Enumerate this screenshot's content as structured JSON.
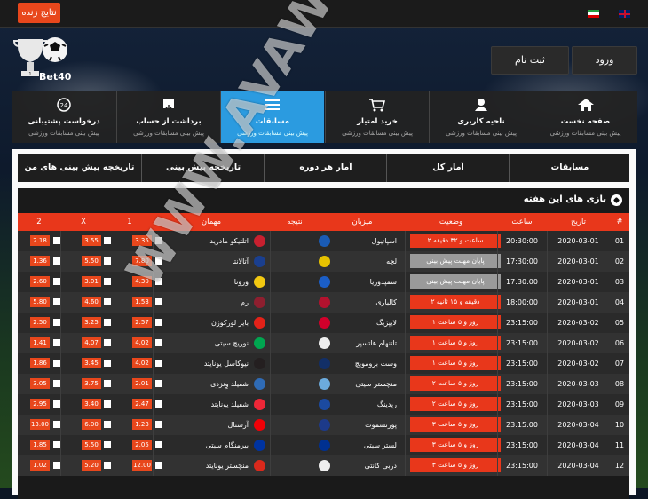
{
  "topbar": {
    "live_label": "نتایج زنده"
  },
  "header": {
    "logo_text": "Bet40",
    "login_label": "ورود",
    "register_label": "ثبت نام"
  },
  "nav": [
    {
      "label": "صفحه نخست",
      "sub": "پیش بینی مسابقات ورزشی",
      "icon": "home-icon",
      "active": false
    },
    {
      "label": "ناحیه کاربری",
      "sub": "پیش بینی مسابقات ورزشی",
      "icon": "user-icon",
      "active": false
    },
    {
      "label": "خرید امتیاز",
      "sub": "پیش بینی مسابقات ورزشی",
      "icon": "cart-icon",
      "active": false
    },
    {
      "label": "مسابقات",
      "sub": "پیش بینی مسابقات ورزشی",
      "icon": "list-icon",
      "active": true
    },
    {
      "label": "برداشت از حساب",
      "sub": "پیش بینی مسابقات ورزشی",
      "icon": "withdraw-icon",
      "active": false
    },
    {
      "label": "درخواست پشتیبانی",
      "sub": "پیش بینی مسابقات ورزشی",
      "icon": "support-24-icon",
      "active": false
    }
  ],
  "tabs": [
    "مسابقات",
    "آمار کل",
    "آمار هر دوره",
    "تاریخچه پیش بینی",
    "تاریخچه پیش بینی های من"
  ],
  "section": {
    "title": "بازی های این هفته"
  },
  "columns": {
    "num": "#",
    "date": "تاریخ",
    "time": "ساعت",
    "status": "وضعیت",
    "host": "میزبان",
    "result": "نتیجه",
    "guest": "مهمان",
    "one": "1",
    "x": "X",
    "two": "2"
  },
  "rows": [
    {
      "num": "01",
      "date": "2020-03-01",
      "time": "20:30:00",
      "status": "۲ ساعت و ۳۲ دقیقه",
      "status_kind": "red",
      "host": "اسپانیول",
      "host_color": "#1a5bb5",
      "guest": "اتلتیکو مادرید",
      "guest_color": "#c8202f",
      "one": "3.35",
      "x": "3.55",
      "two": "2.18"
    },
    {
      "num": "02",
      "date": "2020-03-01",
      "time": "17:30:00",
      "status": "پایان مهلت پیش بینی",
      "status_kind": "gray",
      "host": "لچه",
      "host_color": "#e6c200",
      "guest": "آتالانتا",
      "guest_color": "#1a3f8f",
      "one": "7.80",
      "x": "5.50",
      "two": "1.36"
    },
    {
      "num": "03",
      "date": "2020-03-01",
      "time": "17:30:00",
      "status": "پایان مهلت پیش بینی",
      "status_kind": "gray",
      "host": "سمپدوریا",
      "host_color": "#1b5ec7",
      "guest": "ورونا",
      "guest_color": "#f2c811",
      "one": "4.30",
      "x": "3.01",
      "two": "2.60"
    },
    {
      "num": "04",
      "date": "2020-03-01",
      "time": "18:00:00",
      "status": "۲ دقیقه و ۱۵ ثانیه",
      "status_kind": "red",
      "host": "کالیاری",
      "host_color": "#b3122e",
      "guest": "رم",
      "guest_color": "#8e1f2f",
      "one": "1.53",
      "x": "4.60",
      "two": "5.80"
    },
    {
      "num": "05",
      "date": "2020-03-02",
      "time": "23:15:00",
      "status": "۱ روز و ۵ ساعت",
      "status_kind": "red",
      "host": "لایپزیگ",
      "host_color": "#d2002b",
      "guest": "بایر لورکوزن",
      "guest_color": "#e32219",
      "one": "2.57",
      "x": "3.25",
      "two": "2.50"
    },
    {
      "num": "06",
      "date": "2020-03-02",
      "time": "23:15:00",
      "status": "۱ روز و ۵ ساعت",
      "status_kind": "red",
      "host": "تاتنهام هاتسپر",
      "host_color": "#eeeeee",
      "guest": "نوریچ سیتی",
      "guest_color": "#00a650",
      "one": "4.02",
      "x": "4.07",
      "two": "1.41"
    },
    {
      "num": "07",
      "date": "2020-03-02",
      "time": "23:15:00",
      "status": "۱ روز و ۵ ساعت",
      "status_kind": "red",
      "host": "وست برومویچ",
      "host_color": "#122f67",
      "guest": "نیوکاسل یونایتد",
      "guest_color": "#241f20",
      "one": "4.02",
      "x": "3.45",
      "two": "1.86"
    },
    {
      "num": "08",
      "date": "2020-03-03",
      "time": "23:15:00",
      "status": "۲ روز و ۵ ساعت",
      "status_kind": "red",
      "host": "منچستر سیتی",
      "host_color": "#6cabdd",
      "guest": "شفیلد وِنزدی",
      "guest_color": "#2f6bb5",
      "one": "2.01",
      "x": "3.75",
      "two": "3.05"
    },
    {
      "num": "09",
      "date": "2020-03-03",
      "time": "23:15:00",
      "status": "۲ روز و ۵ ساعت",
      "status_kind": "red",
      "host": "ریدینگ",
      "host_color": "#1b4aa0",
      "guest": "شفیلد یونایتد",
      "guest_color": "#ee2737",
      "one": "2.47",
      "x": "3.40",
      "two": "2.95"
    },
    {
      "num": "10",
      "date": "2020-03-04",
      "time": "23:15:00",
      "status": "۳ روز و ۵ ساعت",
      "status_kind": "red",
      "host": "پورتسموث",
      "host_color": "#1d3a8a",
      "guest": "آرسنال",
      "guest_color": "#ef0107",
      "one": "1.23",
      "x": "6.00",
      "two": "13.00"
    },
    {
      "num": "11",
      "date": "2020-03-04",
      "time": "23:15:00",
      "status": "۳ روز و ۵ ساعت",
      "status_kind": "red",
      "host": "لستر سیتی",
      "host_color": "#003090",
      "guest": "بیرمنگام سیتی",
      "guest_color": "#0033a0",
      "one": "2.05",
      "x": "5.50",
      "two": "1.85"
    },
    {
      "num": "12",
      "date": "2020-03-04",
      "time": "23:15:00",
      "status": "۳ روز و ۵ ساعت",
      "status_kind": "red",
      "host": "دربی کانتی",
      "host_color": "#eeeeee",
      "guest": "منچستر یونایتد",
      "guest_color": "#da291c",
      "one": "12.00",
      "x": "5.20",
      "two": "1.02"
    }
  ],
  "watermark": "WWW.AVAWEB.NET"
}
